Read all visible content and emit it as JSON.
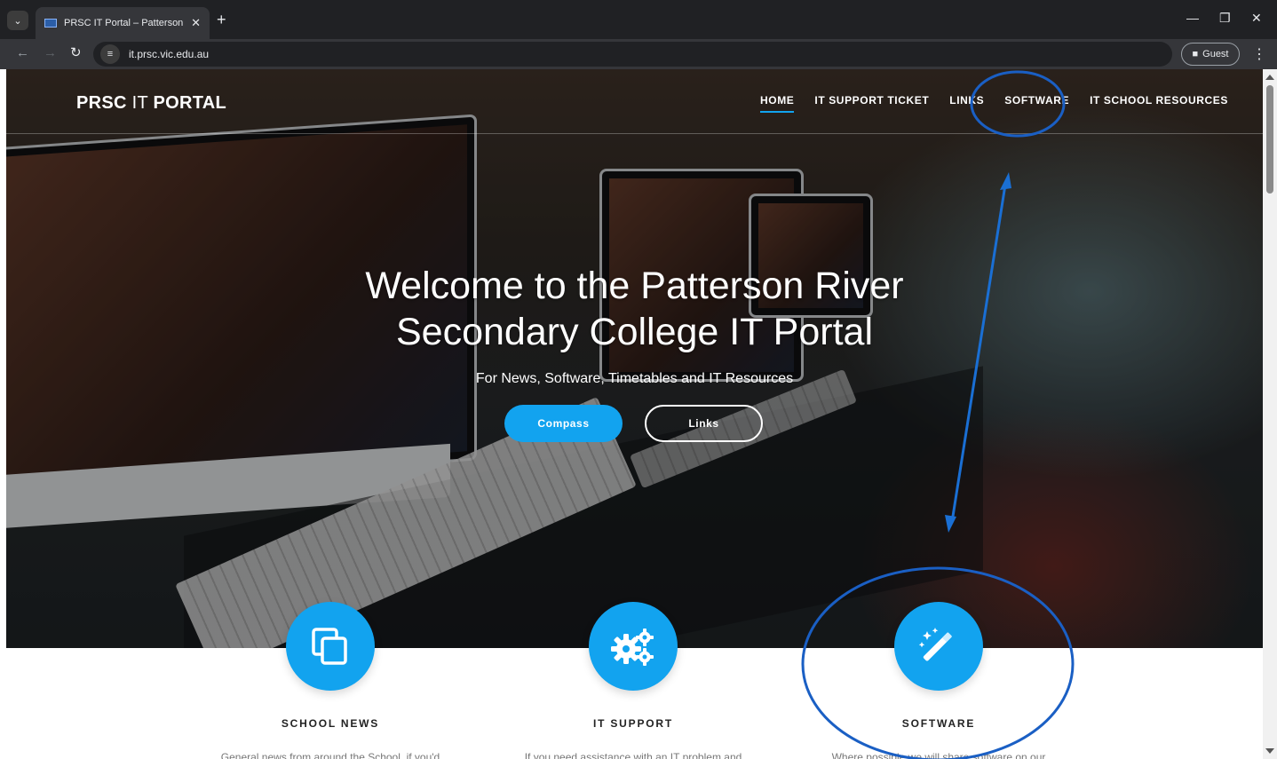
{
  "browser": {
    "tab_title": "PRSC IT Portal – Patterson River",
    "url": "it.prsc.vic.edu.au",
    "profile_label": "Guest",
    "icons": [
      "tab-list-icon",
      "favicon-icon",
      "close-icon",
      "new-tab-icon",
      "back-icon",
      "forward-icon",
      "reload-icon",
      "site-info-icon",
      "profile-icon",
      "menu-icon",
      "minimize-icon",
      "restore-icon",
      "window-close-icon"
    ]
  },
  "site": {
    "brand_bold": "PRSC",
    "brand_thin": "IT",
    "brand_bold2": "PORTAL",
    "nav": [
      {
        "label": "HOME",
        "active": true
      },
      {
        "label": "IT SUPPORT TICKET",
        "active": false
      },
      {
        "label": "LINKS",
        "active": false
      },
      {
        "label": "SOFTWARE",
        "active": false
      },
      {
        "label": "IT SCHOOL RESOURCES",
        "active": false
      }
    ],
    "hero": {
      "title_line1": "Welcome to the Patterson River",
      "title_line2": "Secondary College IT Portal",
      "subtitle": "For News, Software, Timetables and IT Resources",
      "primary_button": "Compass",
      "secondary_button": "Links"
    },
    "features": [
      {
        "icon": "copy-icon",
        "title": "SCHOOL NEWS",
        "text": "General news from around the School, if you'd"
      },
      {
        "icon": "gears-icon",
        "title": "IT SUPPORT",
        "text": "If you need assistance with an IT problem and"
      },
      {
        "icon": "magic-wand-icon",
        "title": "SOFTWARE",
        "text": "Where possible we will share software on our"
      }
    ],
    "accent_color": "#12a3ef",
    "annotation_color": "#1a5fc4"
  }
}
